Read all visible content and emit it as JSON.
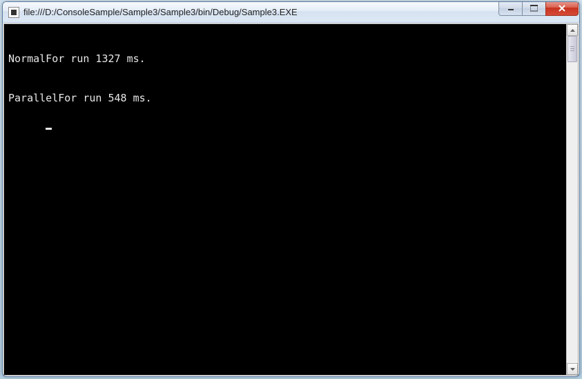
{
  "window": {
    "title": "file:///D:/ConsoleSample/Sample3/Sample3/bin/Debug/Sample3.EXE"
  },
  "console": {
    "lines": [
      "NormalFor run 1327 ms.",
      "ParallelFor run 548 ms."
    ]
  }
}
